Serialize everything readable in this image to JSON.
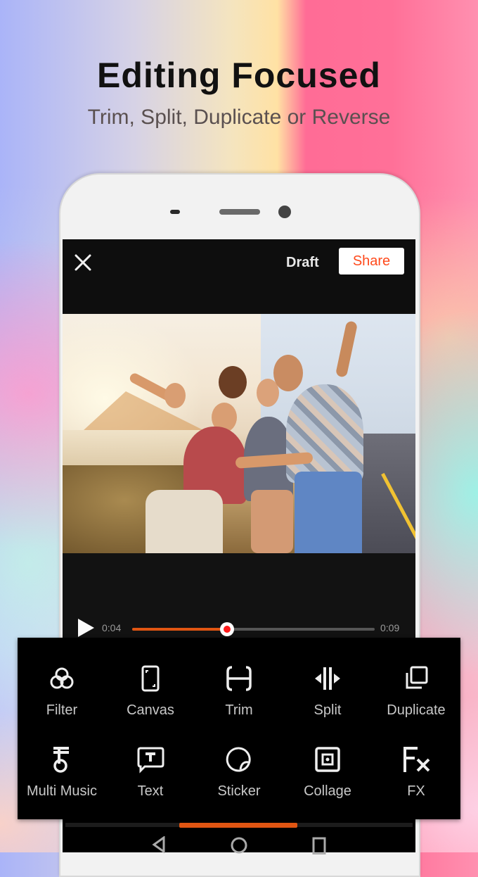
{
  "promo": {
    "headline": "Editing Focused",
    "subline": "Trim, Split, Duplicate or Reverse"
  },
  "editor": {
    "topbar": {
      "close_icon": "close-icon",
      "draft_label": "Draft",
      "share_label": "Share"
    },
    "video": {
      "description": "Group of friends taking a selfie by a coastal road at sunset"
    },
    "player": {
      "current_time": "0:04",
      "end_time": "0:09",
      "progress": 0.39
    },
    "tools": [
      {
        "label": "Filter",
        "icon": "filter-icon"
      },
      {
        "label": "Canvas",
        "icon": "canvas-icon"
      },
      {
        "label": "Trim",
        "icon": "trim-icon"
      },
      {
        "label": "Split",
        "icon": "split-icon"
      },
      {
        "label": "Duplicate",
        "icon": "duplicate-icon"
      },
      {
        "label": "Multi Music",
        "icon": "music-icon"
      },
      {
        "label": "Text",
        "icon": "text-icon"
      },
      {
        "label": "Sticker",
        "icon": "sticker-icon"
      },
      {
        "label": "Collage",
        "icon": "collage-icon"
      },
      {
        "label": "FX",
        "icon": "fx-icon"
      }
    ],
    "nav": [
      "back",
      "home",
      "recents"
    ],
    "colors": {
      "accent": "#e05512",
      "share_text": "#ff4a1c",
      "knob_center": "#ff1a1a"
    }
  }
}
